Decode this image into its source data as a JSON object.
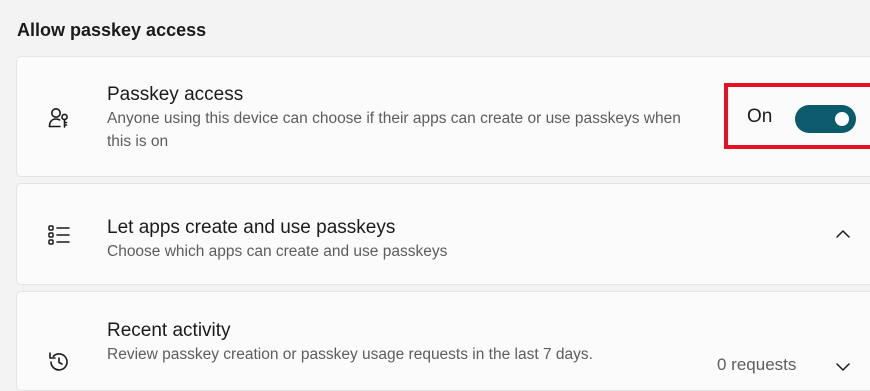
{
  "section": {
    "title": "Allow passkey access"
  },
  "passkey_access": {
    "icon": "person-key-icon",
    "title": "Passkey access",
    "description": "Anyone using this device can choose if their apps can create or use passkeys when this is on",
    "toggle_label": "On",
    "toggle_state": true
  },
  "let_apps": {
    "icon": "list-icon",
    "title": "Let apps create and use passkeys",
    "description": "Choose which apps can create and use passkeys",
    "chevron": "chevron-up-icon"
  },
  "recent_activity": {
    "icon": "history-icon",
    "title": "Recent activity",
    "description": "Review passkey creation or passkey usage requests in the last 7 days.",
    "requests": "0 requests",
    "chevron": "chevron-down-icon"
  },
  "colors": {
    "accent": "#0b5b6d",
    "highlight": "#e81123"
  }
}
